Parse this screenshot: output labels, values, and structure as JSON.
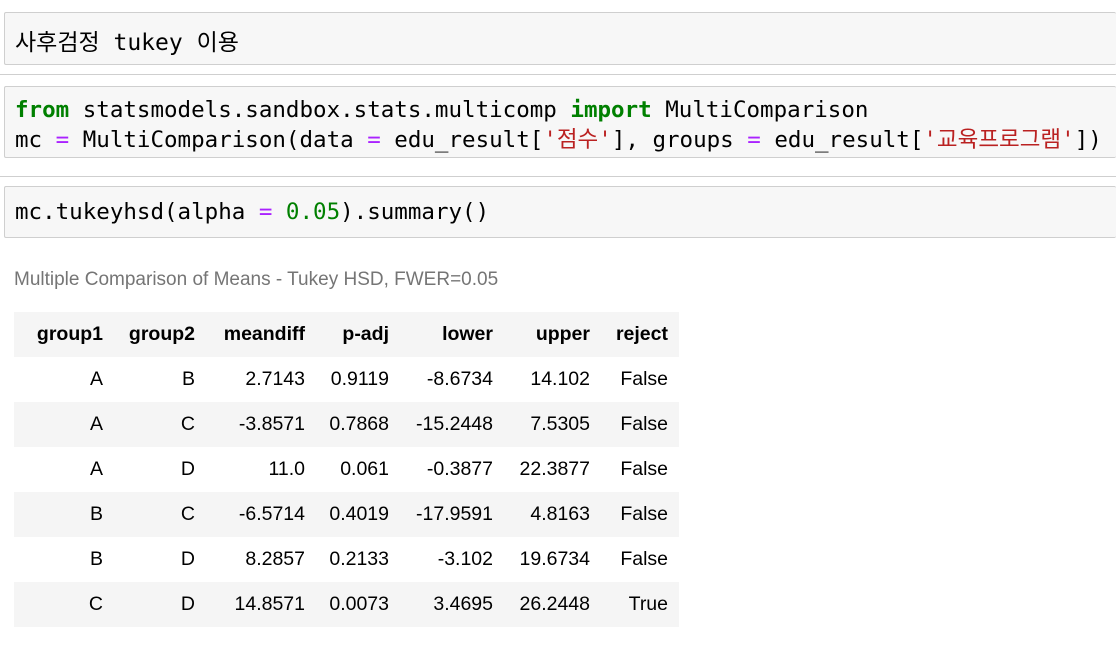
{
  "markdown_cell": {
    "text": "사후검정 tukey 이용"
  },
  "code_cell_1": {
    "line1": {
      "kw_from": "from",
      "module": " statsmodels.sandbox.stats.multicomp ",
      "kw_import": "import",
      "name": " MultiComparison"
    },
    "line2": {
      "var": "mc ",
      "eq1": "=",
      "call": " MultiComparison(data ",
      "eq2": "=",
      "arg1_open": " edu_result[",
      "str1": "'점수'",
      "arg1_close": "], groups ",
      "eq3": "=",
      "arg2_open": " edu_result[",
      "str2": "'교육프로그램'",
      "close": "])"
    }
  },
  "code_cell_2": {
    "prefix": "mc.tukeyhsd(alpha ",
    "eq": "=",
    "num": " 0.05",
    "suffix": ").summary()"
  },
  "output": {
    "caption": "Multiple Comparison of Means - Tukey HSD, FWER=0.05",
    "columns": [
      "group1",
      "group2",
      "meandiff",
      "p-adj",
      "lower",
      "upper",
      "reject"
    ],
    "rows": [
      [
        "A",
        "B",
        "2.7143",
        "0.9119",
        "-8.6734",
        "14.102",
        "False"
      ],
      [
        "A",
        "C",
        "-3.8571",
        "0.7868",
        "-15.2448",
        "7.5305",
        "False"
      ],
      [
        "A",
        "D",
        "11.0",
        "0.061",
        "-0.3877",
        "22.3877",
        "False"
      ],
      [
        "B",
        "C",
        "-6.5714",
        "0.4019",
        "-17.9591",
        "4.8163",
        "False"
      ],
      [
        "B",
        "D",
        "8.2857",
        "0.2133",
        "-3.102",
        "19.6734",
        "False"
      ],
      [
        "C",
        "D",
        "14.8571",
        "0.0073",
        "3.4695",
        "26.2448",
        "True"
      ]
    ]
  },
  "colors": {
    "keyword": "#008000",
    "operator": "#aa22ff",
    "string": "#ba2121",
    "number": "#008000",
    "caption": "#757575",
    "cell_bg": "#f7f7f7",
    "cell_border": "#cfcfcf"
  }
}
